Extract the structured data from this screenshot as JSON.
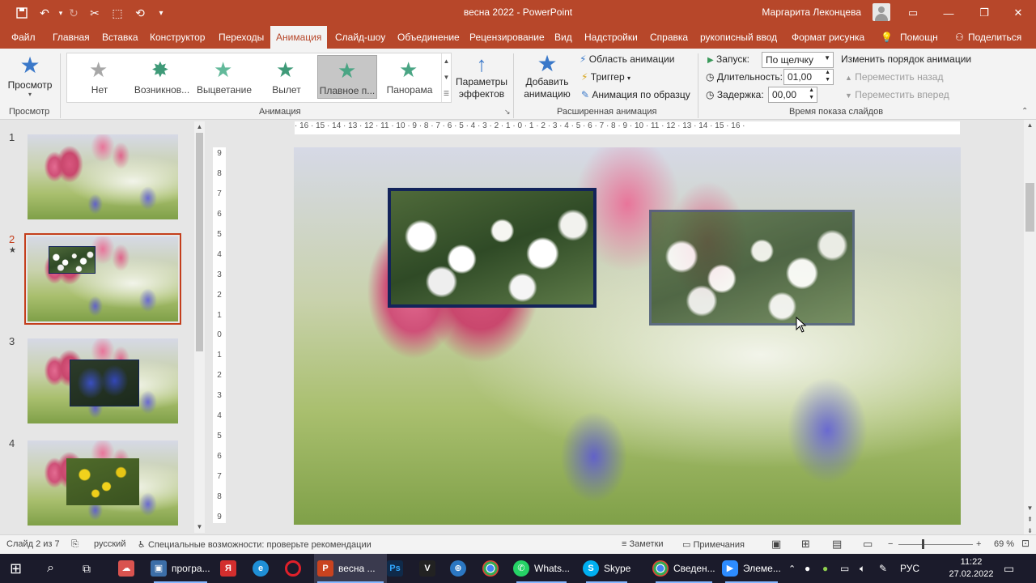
{
  "titlebar": {
    "document_title": "весна 2022  -  PowerPoint",
    "user_name": "Маргарита Леконцева",
    "icons": [
      "save-icon",
      "undo-icon",
      "redo-icon",
      "cut-icon",
      "format-painter-icon",
      "customize-icon"
    ]
  },
  "menu": {
    "tabs": [
      "Файл",
      "Главная",
      "Вставка",
      "Конструктор",
      "Переходы",
      "Анимация",
      "Слайд-шоу",
      "Объединение",
      "Рецензирование",
      "Вид",
      "Надстройки",
      "Справка",
      "рукописный ввод",
      "Формат рисунка"
    ],
    "active_tab": "Анимация",
    "help": "Помощн",
    "share": "Поделиться"
  },
  "ribbon": {
    "preview": {
      "label": "Просмотр",
      "group": "Просмотр"
    },
    "animation_group": "Анимация",
    "gallery": [
      "Нет",
      "Возникнов...",
      "Выцветание",
      "Вылет",
      "Плавное п...",
      "Панорама"
    ],
    "gallery_selected": "Плавное п...",
    "effect_params": "Параметры эффектов",
    "add_animation": "Добавить анимацию",
    "anim_pane": "Область анимации",
    "trigger": "Триггер",
    "anim_painter": "Анимация по образцу",
    "advanced_group": "Расширенная анимация",
    "start_label": "Запуск:",
    "start_value": "По щелчку",
    "duration_label": "Длительность:",
    "duration_value": "01,00",
    "delay_label": "Задержка:",
    "delay_value": "00,00",
    "reorder": "Изменить порядок анимации",
    "move_back": "Переместить назад",
    "move_forward": "Переместить вперед",
    "timing_group": "Время показа слайдов"
  },
  "slides": {
    "numbers": [
      "1",
      "2",
      "3",
      "4"
    ],
    "selected": "2",
    "star_marker": "★"
  },
  "ruler": {
    "top": "· 16 · 15 · 14 · 13 · 12 · 11 · 10 · 9 · 8 · 7 · 6 · 5 · 4 · 3 · 2 · 1 · 0 · 1 · 2 · 3 · 4 · 5 · 6 · 7 · 8 · 9 · 10 · 11 · 12 · 13 · 14 · 15 · 16 ·",
    "left": [
      "9",
      "8",
      "7",
      "6",
      "5",
      "4",
      "3",
      "2",
      "1",
      "0",
      "1",
      "2",
      "3",
      "4",
      "5",
      "6",
      "7",
      "8",
      "9"
    ]
  },
  "statusbar": {
    "slide_info": "Слайд 2 из 7",
    "language": "русский",
    "accessibility": "Специальные возможности: проверьте рекомендации",
    "notes": "Заметки",
    "comments": "Примечания",
    "zoom": "69 %"
  },
  "taskbar": {
    "apps": [
      "програ...",
      "весна ...",
      "Whats...",
      "Skype",
      "Сведен...",
      "Элеме..."
    ],
    "language": "РУС",
    "time": "11:22",
    "date": "27.02.2022"
  },
  "colors": {
    "accent": "#b7472a",
    "taskbar": "#1b1b2b",
    "ribbon": "#f3f3f3"
  }
}
